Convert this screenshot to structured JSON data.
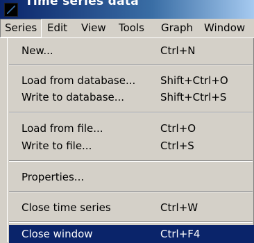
{
  "window": {
    "title": "Time series data"
  },
  "menubar": {
    "items": [
      {
        "label": "Series"
      },
      {
        "label": "Edit"
      },
      {
        "label": "View"
      },
      {
        "label": "Tools"
      },
      {
        "label": "Graph"
      },
      {
        "label": "Window"
      }
    ],
    "open_menu": "Series"
  },
  "series_menu": {
    "items": [
      {
        "label": "New...",
        "shortcut": "Ctrl+N"
      },
      {
        "label": "Load from database...",
        "shortcut": "Shift+Ctrl+O"
      },
      {
        "label": "Write to database...",
        "shortcut": "Shift+Ctrl+S"
      },
      {
        "label": "Load from file...",
        "shortcut": "Ctrl+O"
      },
      {
        "label": "Write to file...",
        "shortcut": "Ctrl+S"
      },
      {
        "label": "Properties..."
      },
      {
        "label": "Close time series",
        "shortcut": "Ctrl+W"
      },
      {
        "label": "Close window",
        "shortcut": "Ctrl+F4"
      }
    ],
    "highlighted_item": "Close window"
  },
  "colors": {
    "menu_background": "#d4d0c8",
    "highlight": "#0a246a",
    "title_gradient_start": "#0a246a",
    "title_gradient_end": "#a6caf0"
  }
}
